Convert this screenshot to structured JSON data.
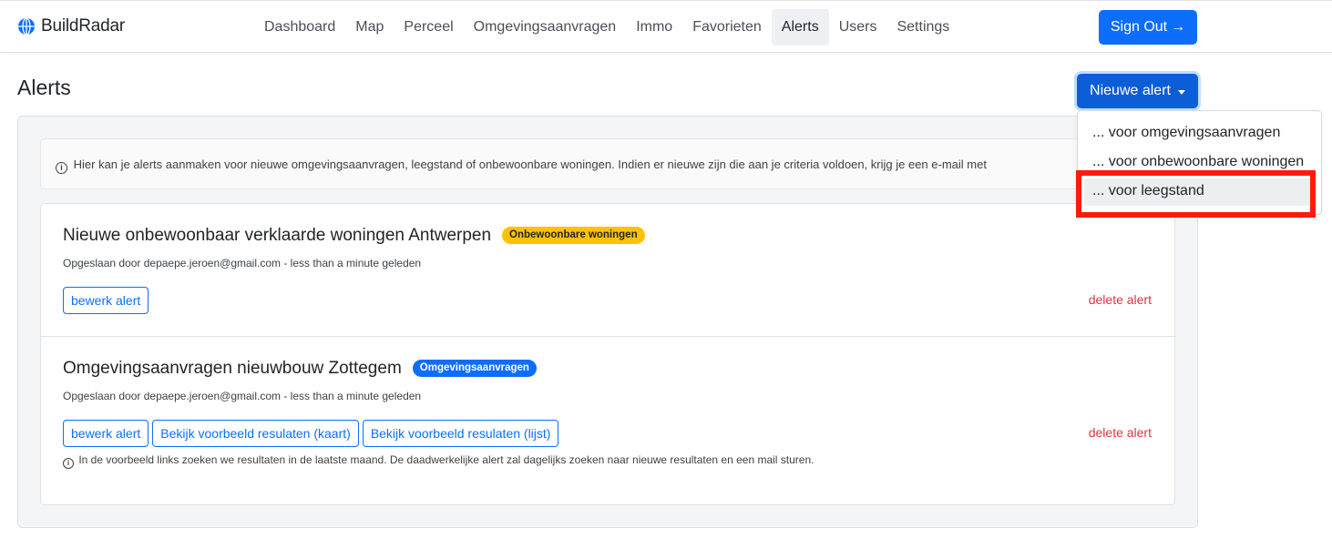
{
  "brand": {
    "name": "BuildRadar"
  },
  "nav": {
    "items": [
      {
        "label": "Dashboard",
        "key": "dashboard"
      },
      {
        "label": "Map",
        "key": "map"
      },
      {
        "label": "Perceel",
        "key": "perceel"
      },
      {
        "label": "Omgevingsaanvragen",
        "key": "omgevingsaanvragen"
      },
      {
        "label": "Immo",
        "key": "immo"
      },
      {
        "label": "Favorieten",
        "key": "favorieten"
      },
      {
        "label": "Alerts",
        "key": "alerts",
        "active": true
      },
      {
        "label": "Users",
        "key": "users"
      },
      {
        "label": "Settings",
        "key": "settings"
      }
    ],
    "sign_out": "Sign Out",
    "sign_out_arrow": "→"
  },
  "page": {
    "title": "Alerts",
    "new_alert_label": "Nieuwe alert",
    "info_icon_glyph": "i",
    "info_text": "Hier kan je alerts aanmaken voor nieuwe omgevingsaanvragen, leegstand of onbewoonbare woningen. Indien er nieuwe zijn die aan je criteria voldoen, krijg je een e-mail met"
  },
  "dropdown": {
    "items": [
      "... voor omgevingsaanvragen",
      "... voor onbewoonbare woningen",
      "... voor leegstand"
    ],
    "highlighted_index": 2
  },
  "alerts": [
    {
      "title": "Nieuwe onbewoonbaar verklaarde woningen Antwerpen",
      "badge": "Onbewoonbare woningen",
      "badge_color": "#ffc107",
      "meta": "Opgeslaan door depaepe.jeroen@gmail.com - less than a minute geleden",
      "buttons": [
        "bewerk alert"
      ],
      "delete_label": "delete alert"
    },
    {
      "title": "Omgevingsaanvragen nieuwbouw Zottegem",
      "badge": "Omgevingsaanvragen",
      "badge_color": "#0d6efd",
      "meta": "Opgeslaan door depaepe.jeroen@gmail.com - less than a minute geleden",
      "buttons": [
        "bewerk alert",
        "Bekijk voorbeeld resulaten (kaart)",
        "Bekijk voorbeeld resulaten (lijst)"
      ],
      "delete_label": "delete alert",
      "hint": "In de voorbeeld links zoeken we resultaten in de laatste maand. De daadwerkelijke alert zal dagelijks zoeken naar nieuwe resultaten en een mail sturen."
    }
  ],
  "colors": {
    "primary": "#0d6efd",
    "danger": "#dc3545",
    "warning": "#ffc107",
    "annotation_red": "#ff1a0a"
  }
}
